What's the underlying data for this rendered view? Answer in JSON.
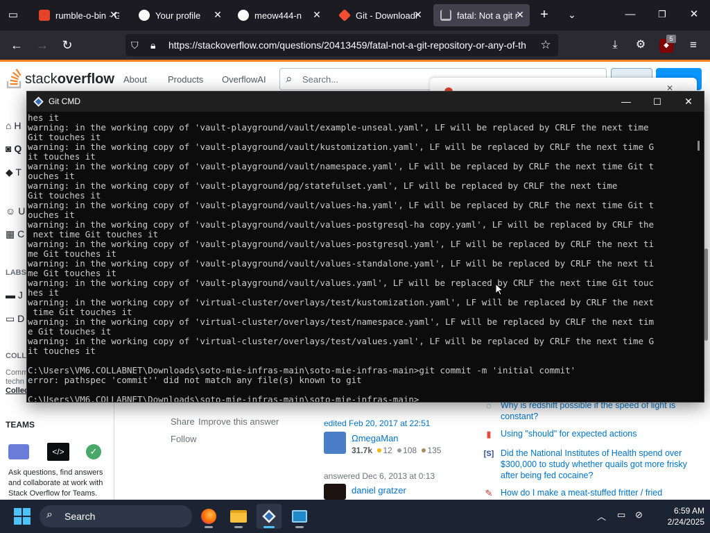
{
  "browser": {
    "tabs": [
      {
        "label": "rumble-o-bin · G",
        "favicon": "gitlab-icon",
        "active": false
      },
      {
        "label": "Your profile",
        "favicon": "github-icon",
        "active": false
      },
      {
        "label": "meow444-n",
        "favicon": "github-icon",
        "active": false
      },
      {
        "label": "Git - Downloadi",
        "favicon": "git-icon",
        "active": false
      },
      {
        "label": "fatal: Not a git r",
        "favicon": "stackoverflow-icon",
        "active": true
      }
    ],
    "url": "https://stackoverflow.com/questions/20413459/fatal-not-a-git-repository-or-any-of-th",
    "extension_badge": "5"
  },
  "so": {
    "logo_light": "stack",
    "logo_bold": "overflow",
    "nav": [
      "About",
      "Products",
      "OverflowAI"
    ],
    "search_placeholder": "Search...",
    "left_items": [
      "H",
      "Q",
      "T",
      "U",
      "C",
      "LABS",
      "J",
      "D",
      "COLLE",
      "Comm",
      "techn",
      "Collec"
    ],
    "teams_title": "TEAMS",
    "teams_text": "Ask questions, find answers and collaborate at work with Stack Overflow for Teams.",
    "share": "Share",
    "improve": "Improve this answer",
    "follow": "Follow",
    "edited": "edited Feb 20, 2017 at 22:51",
    "editor_name": "ΩmegaMan",
    "editor_rep": "31.7k",
    "editor_gold": "12",
    "editor_silver": "108",
    "editor_bronze": "135",
    "answered": "answered Dec 6, 2013 at 0:13",
    "answerer_name": "daniel gratzer",
    "hot_questions": [
      "Why is redshift possible if the speed of light is constant?",
      "Using \"should\" for expected actions",
      "Did the National Institutes of Health spend over $300,000 to study whether quails got more frisky after being fed cocaine?",
      "How do I make a meat-stuffed fritter / fried"
    ]
  },
  "cmd": {
    "title": "Git CMD",
    "lines": [
      "hes it",
      "warning: in the working copy of 'vault-playground/vault/example-unseal.yaml', LF will be replaced by CRLF the next time",
      "Git touches it",
      "warning: in the working copy of 'vault-playground/vault/kustomization.yaml', LF will be replaced by CRLF the next time G",
      "it touches it",
      "warning: in the working copy of 'vault-playground/vault/namespace.yaml', LF will be replaced by CRLF the next time Git t",
      "ouches it",
      "warning: in the working copy of 'vault-playground/pg/statefulset.yaml', LF will be replaced by CRLF the next time",
      "Git touches it",
      "warning: in the working copy of 'vault-playground/vault/values-ha.yaml', LF will be replaced by CRLF the next time Git t",
      "ouches it",
      "warning: in the working copy of 'vault-playground/vault/values-postgresql-ha copy.yaml', LF will be replaced by CRLF the",
      " next time Git touches it",
      "warning: in the working copy of 'vault-playground/vault/values-postgresql.yaml', LF will be replaced by CRLF the next ti",
      "me Git touches it",
      "warning: in the working copy of 'vault-playground/vault/values-standalone.yaml', LF will be replaced by CRLF the next ti",
      "me Git touches it",
      "warning: in the working copy of 'vault-playground/vault/values.yaml', LF will be replaced by CRLF the next time Git touc",
      "hes it",
      "warning: in the working copy of 'virtual-cluster/overlays/test/kustomization.yaml', LF will be replaced by CRLF the next",
      " time Git touches it",
      "warning: in the working copy of 'virtual-cluster/overlays/test/namespace.yaml', LF will be replaced by CRLF the next tim",
      "e Git touches it",
      "warning: in the working copy of 'virtual-cluster/overlays/test/values.yaml', LF will be replaced by CRLF the next time G",
      "it touches it",
      "",
      "C:\\Users\\VM6.COLLABNET\\Downloads\\soto-mie-infras-main\\soto-mie-infras-main>git commit -m 'initial commit'",
      "error: pathspec 'commit'' did not match any file(s) known to git",
      "",
      "C:\\Users\\VM6.COLLABNET\\Downloads\\soto-mie-infras-main\\soto-mie-infras-main>"
    ]
  },
  "taskbar": {
    "search_label": "Search",
    "time": "6:59 AM",
    "date": "2/24/2025"
  },
  "colors": {
    "so_orange": "#f48225",
    "so_blue": "#0074cc",
    "terminal_bg": "#0c0c0c",
    "terminal_fg": "#cccccc"
  }
}
